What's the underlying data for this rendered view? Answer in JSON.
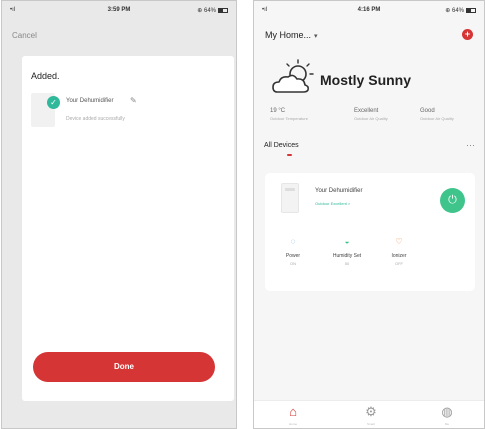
{
  "left": {
    "status": {
      "signal": "•ıl",
      "time": "3:59 PM",
      "battery": "⊕ 64%"
    },
    "cancel_label": "Cancel",
    "added_title": "Added.",
    "device_name": "Your Dehumidifier",
    "device_status": "Device added successfully",
    "done_label": "Done"
  },
  "right": {
    "status": {
      "signal": "•ıl",
      "time": "4:16 PM",
      "battery": "⊕ 64%"
    },
    "home_title": "My Home...",
    "weather_text": "Mostly Sunny",
    "stats": [
      {
        "value": "19 °C",
        "label": "Outdoor Temperature"
      },
      {
        "value": "Excellent",
        "label": "Outdoor Air Quality"
      },
      {
        "value": "Good",
        "label": "Outdoor Air Quality"
      }
    ],
    "section_label": "All Devices",
    "device": {
      "name": "Your Dehumidifier",
      "subtitle": "Outdoor Excellent >",
      "controls": [
        {
          "icon": "power-small-icon",
          "label": "Power",
          "state": "ON"
        },
        {
          "icon": "humidity-icon",
          "label": "Humidity Set",
          "state": "50"
        },
        {
          "icon": "ionizer-icon",
          "label": "Ionizer",
          "state": "OFF"
        }
      ]
    },
    "tabs": [
      {
        "icon": "home-icon",
        "label": "Home"
      },
      {
        "icon": "smart-icon",
        "label": "Smart"
      },
      {
        "icon": "profile-icon",
        "label": "Me"
      }
    ]
  },
  "colors": {
    "accent_red": "#d63535",
    "accent_green": "#3fc48c",
    "check_teal": "#2fb99a"
  }
}
